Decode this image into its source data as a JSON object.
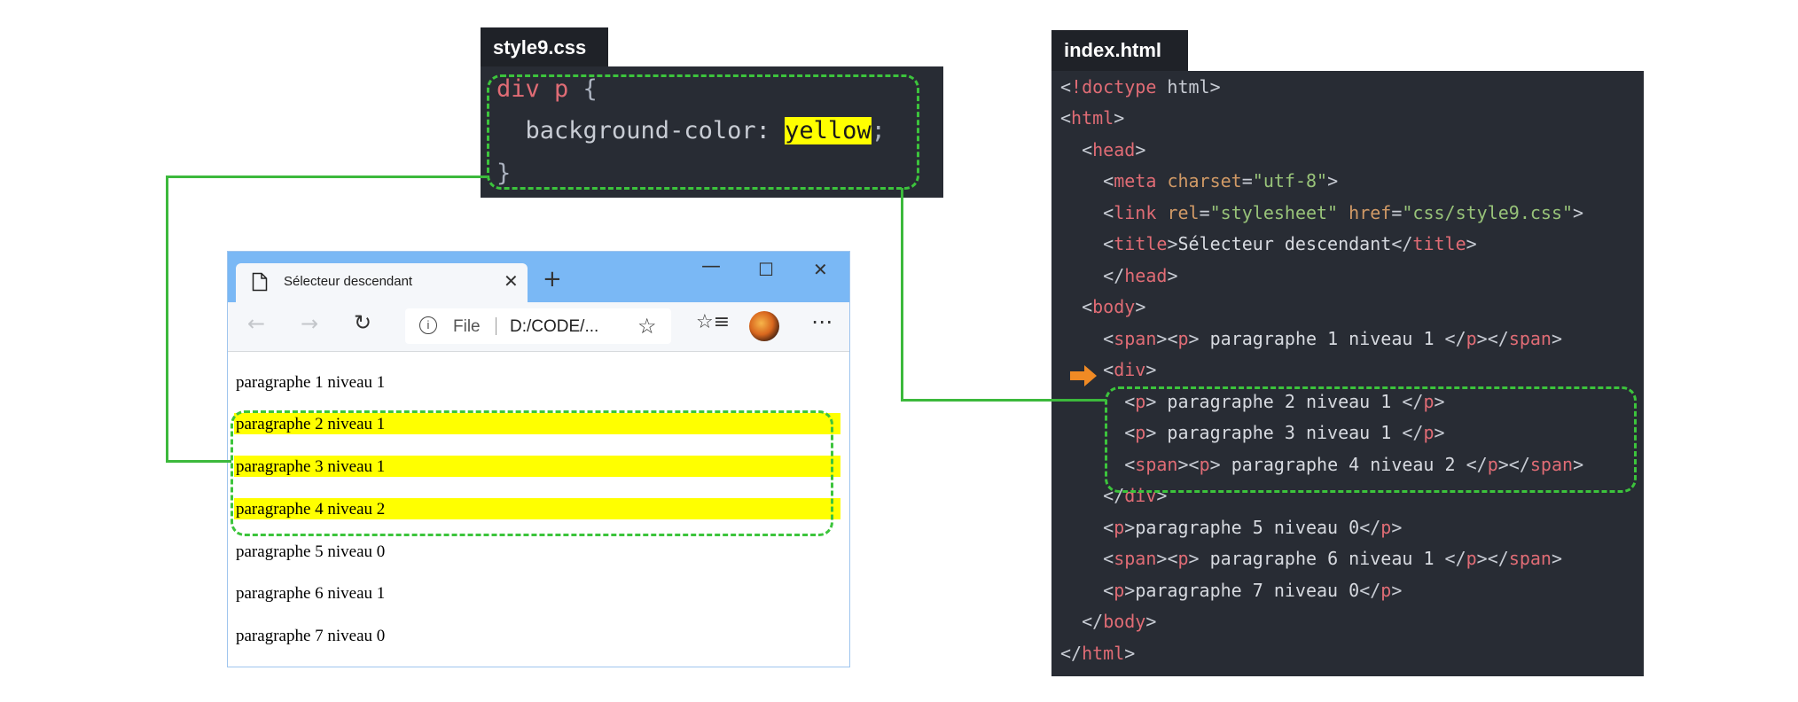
{
  "css_file": {
    "tab": "style9.css",
    "lines": {
      "l1_selector": "div p",
      "l1_brace": " {",
      "l2_prop": "  background-color: ",
      "l2_value": "yellow",
      "l2_semi": ";",
      "l3": "}"
    }
  },
  "html_file": {
    "tab": "index.html",
    "lines": [
      "<!doctype html>",
      "<html>",
      "  <head>",
      "    <meta charset=\"utf-8\">",
      "    <link rel=\"stylesheet\" href=\"css/style9.css\">",
      "    <title>Sélecteur descendant</title>",
      "    </head>",
      "  <body>",
      "    <span><p> paragraphe 1 niveau 1 </p></span>",
      "    <div>",
      "      <p> paragraphe 2 niveau 1 </p>",
      "      <p> paragraphe 3 niveau 1 </p>",
      "      <span><p> paragraphe 4 niveau 2 </p></span>",
      "    </div>",
      "    <p>paragraphe 5 niveau 0</p>",
      "    <span><p> paragraphe 6 niveau 1 </p></span>",
      "    <p>paragraphe 7 niveau 0</p>",
      "  </body>",
      "</html>"
    ]
  },
  "browser": {
    "tab_title": "Sélecteur descendant",
    "address_prefix": "File",
    "address": "D:/CODE/...",
    "paragraphs": [
      {
        "text": "paragraphe 1 niveau 1",
        "highlighted": false
      },
      {
        "text": "paragraphe 2 niveau 1",
        "highlighted": true
      },
      {
        "text": "paragraphe 3 niveau 1",
        "highlighted": true
      },
      {
        "text": "paragraphe 4 niveau 2",
        "highlighted": true
      },
      {
        "text": "paragraphe 5 niveau 0",
        "highlighted": false
      },
      {
        "text": "paragraphe 6 niveau 1",
        "highlighted": false
      },
      {
        "text": "paragraphe 7 niveau 0",
        "highlighted": false
      }
    ]
  },
  "colors": {
    "highlight": "#ffff00",
    "connector": "#3cb93c",
    "code_bg": "#282c34",
    "arrow": "#f08a24"
  }
}
